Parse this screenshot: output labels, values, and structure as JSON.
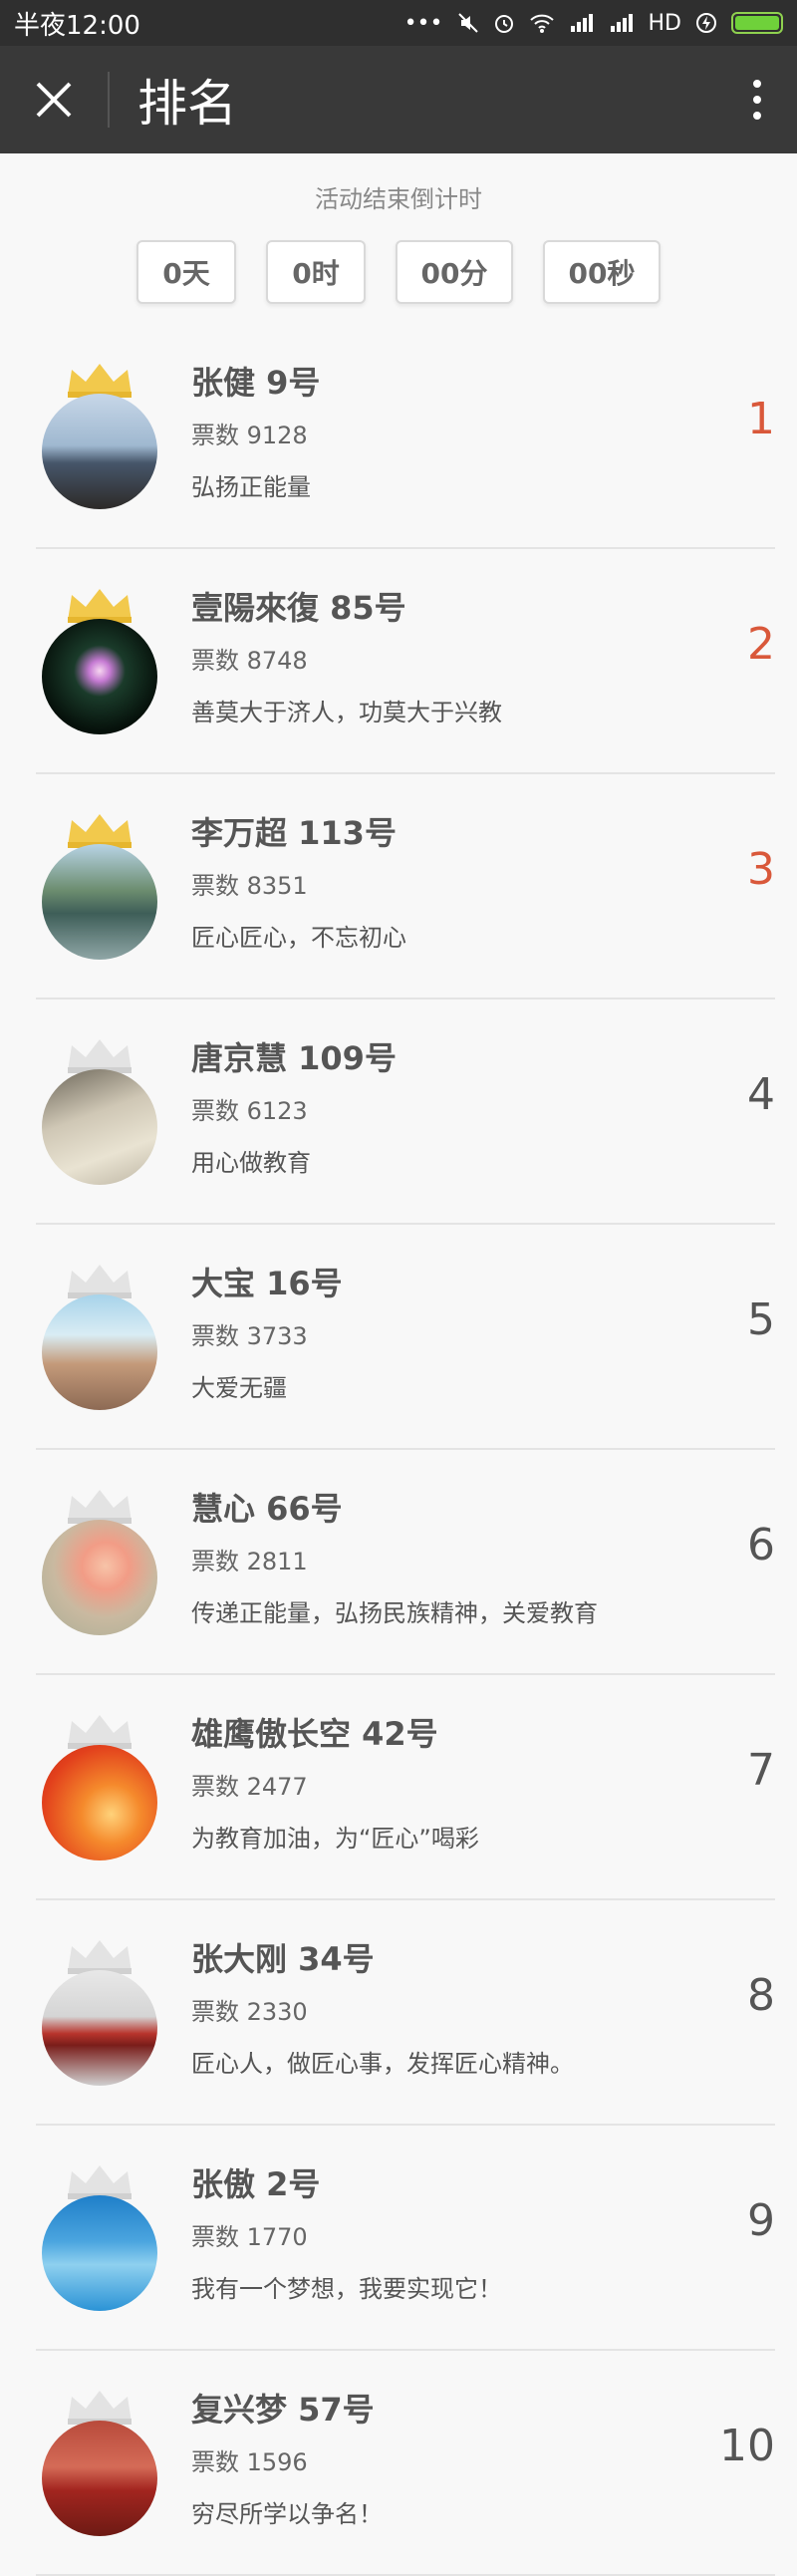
{
  "status_bar": {
    "time": "半夜12:00",
    "icons_text": "•••",
    "network": "HD"
  },
  "header": {
    "title": "排名"
  },
  "countdown": {
    "label": "活动结束倒计时",
    "boxes": [
      "0天",
      "0时",
      "00分",
      "00秒"
    ]
  },
  "colors": {
    "top_rank": "#d9583a",
    "gold_crown": "#f2c94c",
    "gray_crown": "#d7d7d7"
  },
  "entries": [
    {
      "name": "张健  9号",
      "votes": "票数 9128",
      "slogan": "弘扬正能量",
      "rank": "1"
    },
    {
      "name": "壹陽來復  85号",
      "votes": "票数 8748",
      "slogan": "善莫大于济人，功莫大于兴教",
      "rank": "2"
    },
    {
      "name": "李万超  113号",
      "votes": "票数 8351",
      "slogan": "匠心匠心，不忘初心",
      "rank": "3"
    },
    {
      "name": "唐京慧  109号",
      "votes": "票数 6123",
      "slogan": "用心做教育",
      "rank": "4"
    },
    {
      "name": "大宝  16号",
      "votes": "票数 3733",
      "slogan": "大爱无疆",
      "rank": "5"
    },
    {
      "name": "慧心  66号",
      "votes": "票数 2811",
      "slogan": "传递正能量，弘扬民族精神，关爱教育",
      "rank": "6"
    },
    {
      "name": "雄鹰傲长空  42号",
      "votes": "票数 2477",
      "slogan": "为教育加油，为“匠心”喝彩",
      "rank": "7"
    },
    {
      "name": "张大刚  34号",
      "votes": "票数 2330",
      "slogan": "匠心人，做匠心事，发挥匠心精神。",
      "rank": "8"
    },
    {
      "name": "张傲  2号",
      "votes": "票数 1770",
      "slogan": "我有一个梦想，我要实现它！",
      "rank": "9"
    },
    {
      "name": "复兴梦  57号",
      "votes": "票数 1596",
      "slogan": "穷尽所学以争名！",
      "rank": "10"
    }
  ]
}
